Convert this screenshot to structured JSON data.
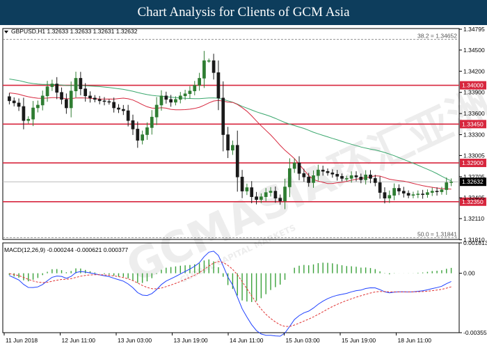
{
  "header": {
    "title": "Chart Analysis for Clients of GCM Asia"
  },
  "watermark": {
    "main": "GCMASIA环汇亚洲",
    "sub": "GLOBAL CAPITAL MARKETS"
  },
  "colors": {
    "bull": "#2f7d32",
    "bear": "#1a1a1a",
    "ma_fast": "#d7263d",
    "ma_slow": "#3aa76d",
    "level": "#d7263d",
    "macd": "#1e40ff",
    "signal": "#e03030",
    "hist": "#3aa13a",
    "header_bg": "#0d3d5c",
    "price_tag": "#000000"
  },
  "chart_data": [
    {
      "type": "candlestick",
      "symbol": "GBPUSD,H1",
      "info": "GBPUSD,H1  1.32633 1.32633 1.32631 1.32632",
      "ylim": [
        1.31815,
        1.34805
      ],
      "y_ticks": [
        "1.34795",
        "1.34500",
        "1.34200",
        "1.33900",
        "1.33600",
        "1.33300",
        "1.33005",
        "1.32705",
        "1.32405",
        "1.32110",
        "1.31810"
      ],
      "levels": [
        {
          "value": 1.34,
          "label": "1.34000"
        },
        {
          "value": 1.3345,
          "label": "1.33450"
        },
        {
          "value": 1.329,
          "label": "1.32900"
        },
        {
          "value": 1.3235,
          "label": "1.32350"
        }
      ],
      "fib_levels": [
        {
          "value": 1.34652,
          "label": "38.2 = 1.34652"
        },
        {
          "value": 1.31841,
          "label": "50.0 = 1.31841"
        }
      ],
      "current_price": {
        "value": 1.32632,
        "label": "1.32632"
      },
      "x_labels": [
        "11 Jun 2018",
        "12 Jun 11:00",
        "13 Jun 03:00",
        "13 Jun 19:00",
        "14 Jun 11:00",
        "15 Jun 03:00",
        "15 Jun 19:00",
        "18 Jun 11:00"
      ],
      "close": [
        1.3378,
        1.3375,
        1.337,
        1.335,
        1.3352,
        1.3368,
        1.3372,
        1.3385,
        1.3398,
        1.3402,
        1.339,
        1.338,
        1.3368,
        1.3392,
        1.341,
        1.3395,
        1.3385,
        1.3382,
        1.338,
        1.3378,
        1.3377,
        1.3376,
        1.3368,
        1.3366,
        1.3364,
        1.335,
        1.3338,
        1.3322,
        1.333,
        1.334,
        1.3355,
        1.3372,
        1.3385,
        1.338,
        1.3376,
        1.338,
        1.3385,
        1.3388,
        1.3392,
        1.34,
        1.341,
        1.3435,
        1.3435,
        1.3418,
        1.3382,
        1.333,
        1.3308,
        1.3315,
        1.327,
        1.325,
        1.3255,
        1.3242,
        1.3238,
        1.3242,
        1.3248,
        1.325,
        1.324,
        1.3236,
        1.3256,
        1.3282,
        1.329,
        1.3275,
        1.327,
        1.3262,
        1.3272,
        1.328,
        1.3278,
        1.3276,
        1.3274,
        1.3271,
        1.3268,
        1.3268,
        1.3272,
        1.327,
        1.3266,
        1.3273,
        1.3268,
        1.3262,
        1.3248,
        1.324,
        1.3244,
        1.3254,
        1.325,
        1.3247,
        1.3244,
        1.3245,
        1.3246,
        1.3245,
        1.3248,
        1.325,
        1.3249,
        1.3252,
        1.3262,
        1.3263
      ],
      "ma_fast": {
        "period": 20
      },
      "ma_slow": {
        "period": 50
      }
    },
    {
      "type": "macd",
      "label": "MACD(12,26,9) -0.000244 -0.000621 0.000377",
      "ylim": [
        -0.00355,
        0.001813
      ],
      "y_ticks": [
        "0.001813",
        "0.00",
        "-0.00355"
      ]
    }
  ]
}
